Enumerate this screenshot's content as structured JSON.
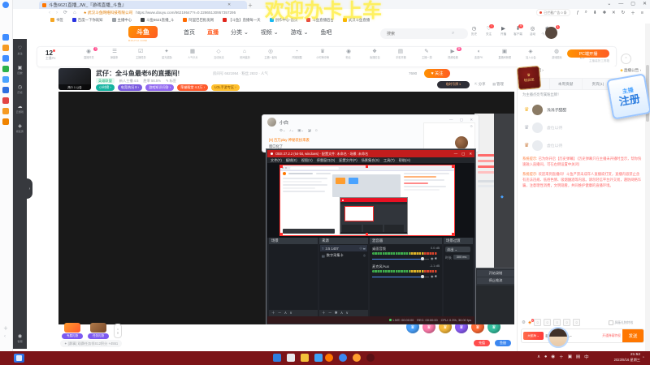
{
  "overlay": {
    "marquee": "欢迎办卡上车"
  },
  "dock": {
    "apps": [
      {
        "color": "#3f8cff"
      },
      {
        "color": "#f59a23"
      },
      {
        "color": "#3f8cff"
      },
      {
        "color": "#2cb24a"
      },
      {
        "color": "#4aa3ff"
      },
      {
        "color": "#2f6fe0"
      },
      {
        "color": "#e24444"
      },
      {
        "color": "#f59a23"
      },
      {
        "color": "#f08300"
      }
    ],
    "more": "＋",
    "collapse": "‹"
  },
  "browser": {
    "tab_title": "斗鱼6621直播_JW_『游戏直播_斗鱼』",
    "tab_close": "✕",
    "new_tab": "＋",
    "window_controls": [
      {
        "glyph": "⌄"
      },
      {
        "glyph": "—"
      },
      {
        "glyph": "▢"
      },
      {
        "glyph": "✕"
      }
    ],
    "nav": {
      "back": "‹",
      "forward": "›",
      "reload": "⟳",
      "home": "⌂"
    },
    "site_chip": "★ 武汉斗鱼网络科技有限公司",
    "url": "https://www.douyu.com/66219547?r=0.22865130957357295",
    "adblock_chip": "已拦截广告 0 条",
    "toolbar_icons": [
      {
        "glyph": "ƒ"
      },
      {
        "glyph": "⌕"
      },
      {
        "glyph": "⬇"
      },
      {
        "glyph": "✚"
      },
      {
        "glyph": "✕"
      },
      {
        "glyph": "↻"
      },
      {
        "glyph": "＋"
      },
      {
        "glyph": "≡"
      }
    ],
    "bookmarks": [
      {
        "color": "#f5a623",
        "label": "书签"
      },
      {
        "color": "#2932e1",
        "label": "百度一下你就知"
      },
      {
        "color": "#9aa0a6",
        "label": "主播中心"
      },
      {
        "color": "#3c4043",
        "label": "斗鱼6621直播_斗"
      },
      {
        "color": "#ff6a00",
        "label": "阿里巴巴批发网"
      },
      {
        "color": "#e1251b",
        "label": "【斗鱼】直播每一天"
      },
      {
        "color": "#12b7f5",
        "label": "创作中心-首页"
      },
      {
        "color": "#e84c3d",
        "label": "斗鱼直播后台"
      },
      {
        "color": "#f8b500",
        "label": "武汉斗鱼直播"
      }
    ]
  },
  "douyu": {
    "header": {
      "logo_text": "斗鱼",
      "logo_sub": "DOUYU.COM",
      "nav": [
        {
          "label": "首页",
          "active": false
        },
        {
          "label": "直播",
          "active": true
        },
        {
          "label": "分类 ⌄",
          "active": false
        },
        {
          "label": "视频 ⌄",
          "active": false
        },
        {
          "label": "游戏 ⌄",
          "active": false
        },
        {
          "label": "鱼吧",
          "active": false
        }
      ],
      "search_placeholder": "搜索",
      "search_icon": "⌕",
      "user_icons": [
        {
          "glyph": "◷",
          "label": "历史",
          "badge": ""
        },
        {
          "glyph": "♡",
          "label": "关注",
          "badge": "•"
        },
        {
          "glyph": "▶",
          "label": "开播",
          "badge": ""
        },
        {
          "glyph": "⬇",
          "label": "客户端",
          "badge": "9"
        },
        {
          "glyph": "◎",
          "label": "活动",
          "badge": ""
        },
        {
          "glyph": "◉",
          "label": "个人中心",
          "badge": ""
        }
      ],
      "avatar_badge": "1"
    },
    "rail": {
      "items": [
        {
          "glyph": "♡",
          "label": "关注"
        },
        {
          "glyph": "▣",
          "label": "回放"
        },
        {
          "glyph": "◷",
          "label": "历史"
        },
        {
          "glyph": "☁",
          "label": "云游戏"
        },
        {
          "glyph": "◈",
          "label": "领任务"
        }
      ],
      "bottom_glyph": "◉",
      "bottom_label": "客服",
      "handle": "›"
    },
    "toolbar": {
      "pk_count": "12",
      "pk_label": "主播PK",
      "items": [
        {
          "glyph": "◉",
          "label": "直播开关",
          "badge": "3"
        },
        {
          "glyph": "☰",
          "label": "弹幕条",
          "badge": ""
        },
        {
          "glyph": "☑",
          "label": "主播任务",
          "badge": ""
        },
        {
          "glyph": "✦",
          "label": "星光奖励",
          "badge": ""
        },
        {
          "glyph": "▦",
          "label": "人气卡片",
          "badge": ""
        },
        {
          "glyph": "◇",
          "label": "互动玩法",
          "badge": ""
        },
        {
          "glyph": "⌂",
          "label": "房间装扮",
          "badge": ""
        },
        {
          "glyph": "◎",
          "label": "主播一起玩",
          "badge": ""
        },
        {
          "glyph": "◔",
          "label": "开播提醒",
          "badge": ""
        },
        {
          "glyph": "♛",
          "label": "小时榜冲榜",
          "badge": ""
        },
        {
          "glyph": "◉",
          "label": "粉丝",
          "badge": ""
        },
        {
          "glyph": "❖",
          "label": "鱼翅红包",
          "badge": ""
        },
        {
          "glyph": "▤",
          "label": "手机开播",
          "badge": ""
        },
        {
          "glyph": "✎",
          "label": "主播一捞",
          "badge": ""
        },
        {
          "glyph": "▶",
          "label": "视频轮播",
          "badge": "新"
        },
        {
          "glyph": "◖",
          "label": "连麦PK",
          "badge": ""
        },
        {
          "glyph": "▣",
          "label": "直播间管理",
          "badge": ""
        },
        {
          "glyph": "◈",
          "label": "加入公会",
          "badge": ""
        },
        {
          "glyph": "◍",
          "label": "游戏陪玩",
          "badge": ""
        },
        {
          "glyph": "⊖",
          "label": "更多",
          "badge": ""
        }
      ],
      "primary_button": "PC端开播",
      "primary_sub": "主播装扮工具箱"
    },
    "room": {
      "cover_caption": "简介 1 公告",
      "title": "武仔：全斗鱼最老6的直播间!",
      "meta": "房间号 6621954 · 粉丝 2832 · 人气",
      "category_tag": "英雄联盟",
      "attrs": [
        {
          "label": "新人主播 4.5"
        },
        {
          "label": "胜率 56.5%"
        },
        {
          "label": "✎ 标签"
        }
      ],
      "badges": [
        {
          "label": "小时榜 ›",
          "bg": "#14b3a0",
          "color": "#ffffff"
        },
        {
          "label": "电竞热况 8 ›",
          "bg": "#7b5ce0",
          "color": "#ffffff"
        },
        {
          "label": "游戏知识问答 ›",
          "bg": "#9168f0",
          "color": "#ffffff"
        },
        {
          "label": "荣誉殿堂 4.3万 ›",
          "bg": "#ff5a2c",
          "color": "#ffffff"
        },
        {
          "label": "LOL手游专区 ›",
          "bg": "#ffc02e",
          "color": "#7a4a00"
        }
      ],
      "viewers": "7690",
      "follow_button": "♥ 关注",
      "plate_badge": "临时号牌 1",
      "share_link": "分享",
      "manage_link": "管理"
    },
    "bottombar": {
      "gifts": [
        {
          "color1": "#ff9d2e",
          "color2": "#ff5a2c",
          "label": "专属礼物"
        },
        {
          "color1": "#b07a4a",
          "color2": "#7a4a2a",
          "label": "任务礼物"
        }
      ],
      "event_note": "✦ [赛事] 观赛任务领S12积分 +4551",
      "quick_gifts": [
        {
          "color": "#4aa3ff"
        },
        {
          "color": "#ff7bac"
        },
        {
          "color": "#f6b93b"
        },
        {
          "color": "#8b5cf6"
        },
        {
          "color": "#ff6b35"
        },
        {
          "color": "#35c0a0"
        }
      ],
      "action_pills": [
        {
          "label": "充值",
          "bg": "#ff4d4d"
        },
        {
          "label": "鱼翅",
          "bg": "#3c87f0"
        }
      ]
    },
    "sidebar": {
      "intro_link": "主播介绍 ›",
      "notice_link": "直播公告 ›",
      "tabs": [
        {
          "label": "今日贡献",
          "active": false
        },
        {
          "label": "本周贡献",
          "active": false
        },
        {
          "label": "贵宾(1)",
          "active": false
        },
        {
          "label": "粉丝(7)",
          "active": true
        }
      ],
      "fan_prompt": "为主播点亮专属粉丝牌！",
      "fan_button": "♥ 成为粉丝",
      "ranks": [
        {
          "crown": "♛",
          "crown_color": "#f6b93b",
          "avatar": "#8a7a64",
          "name": "浅浅子甜甜",
          "muted": false,
          "badge": "贵宾 ♛"
        },
        {
          "crown": "♛",
          "crown_color": "#b8bdc6",
          "avatar": "#e9ecf0",
          "name": "虚位以待",
          "muted": true,
          "badge": ""
        },
        {
          "crown": "♛",
          "crown_color": "#d08a54",
          "avatar": "#e9ecf0",
          "name": "虚位以待",
          "muted": true,
          "badge": ""
        }
      ],
      "system_messages": [
        {
          "tag": "系统提示:",
          "text": "已为你开启【历史弹幕】（历史弹幕只在主播未开播时显示，帮你快速融入直播间，可在右侧设置中关闭）"
        },
        {
          "tag": "系统提示:",
          "text": "欢迎来到直播间！斗鱼严禁未成年人直播或打赏，直播内容禁止含有违法违规、低俗色情、吸烟酗酒等内容。请勿轻信平台外交易，谨防网络诈骗，注意理性消费，文明观看，共同维护健康的直播环境。"
        }
      ],
      "gift_toolbar": {
        "gear": "⚙",
        "gift": "◈",
        "gift_badge": "1",
        "emotes": [
          {
            "face": "☺"
          },
          {
            "face": "☺"
          },
          {
            "face": "☺"
          },
          {
            "face": "☺"
          },
          {
            "face": "☺"
          }
        ],
        "block_label": "屏蔽礼物特效"
      },
      "input": {
        "tag": "大航海 ⌄",
        "placeholder": "和主播说点什么~",
        "priv_link": "开通弹幕特权",
        "send": "发送"
      },
      "fanclub_badge": "粉丝团",
      "register_sticker": {
        "line1": "主播",
        "line2": "注册"
      },
      "float_button": "⌃"
    }
  },
  "captured": {
    "qq": {
      "name": "小白",
      "controls": "—　▢　✕",
      "toolbar": "⚙⌄　♪⌄　▣⌄　◪　☺",
      "panel_gear": "⚙",
      "msg_highlight": "[9] 百万play·神秘装扮来袭",
      "msg": "窗口化了"
    },
    "obs": {
      "title": "OBS 27.2.2 (64-bit, windows) - 配置文件: 未命名 - 场景: 未命名",
      "controls": [
        {
          "glyph": "—"
        },
        {
          "glyph": "▢"
        },
        {
          "glyph": "✕"
        }
      ],
      "menu": [
        {
          "label": "文件(F)"
        },
        {
          "label": "编辑(E)"
        },
        {
          "label": "视图(V)"
        },
        {
          "label": "停靠窗口(D)"
        },
        {
          "label": "配置文件(P)"
        },
        {
          "label": "场景集合(S)"
        },
        {
          "label": "工具(T)"
        },
        {
          "label": "帮助(H)"
        }
      ],
      "scenes_title": "场景",
      "scenes_footer": "＋ － ∧ ∨",
      "sources_title": "来源",
      "sources": [
        {
          "glyph": "T",
          "label": "3.5 1407",
          "meta": "◎ ⬓"
        },
        {
          "glyph": "▤",
          "label": "数字采集卡",
          "meta": "◎"
        }
      ],
      "sources_footer": "＋ － ✱ ∧ ∨",
      "mixer_title": "混音器",
      "tracks": [
        {
          "name": "桌面音频",
          "db": "0.0 dB"
        },
        {
          "name": "麦克风/Aux",
          "db": "-1.1 dB"
        }
      ],
      "transition_title": "场景过渡",
      "transition_value": "淡出 ⌄",
      "duration_label": "时长",
      "duration_value": "300 ms",
      "status": "LIVE: 00:00:00　REC: 00:00:00　CPU: 0.3%, 30.00 fps"
    },
    "side_buttons": [
      {
        "label": "开始录制"
      },
      {
        "label": "停止推流"
      }
    ]
  },
  "taskbar": {
    "start_group": [
      {
        "color": "#2f7fe0"
      },
      {
        "color": "#e8eaed"
      },
      {
        "color": "#f3c13a"
      },
      {
        "color": "#3fa2f7"
      }
    ],
    "app_group": [
      {
        "color": "#ff7700"
      },
      {
        "color": "#3c87f0"
      },
      {
        "color": "#ff9d2e"
      },
      {
        "color": "#5a1015"
      }
    ],
    "tray_glyphs": [
      {
        "glyph": "∧"
      },
      {
        "glyph": "●"
      },
      {
        "glyph": "◉"
      },
      {
        "glyph": "＋"
      },
      {
        "glyph": "▣"
      },
      {
        "glyph": "▤"
      },
      {
        "glyph": "中"
      }
    ],
    "time": "21:52",
    "date": "2023/8/16 星期三",
    "bell": "◔"
  }
}
